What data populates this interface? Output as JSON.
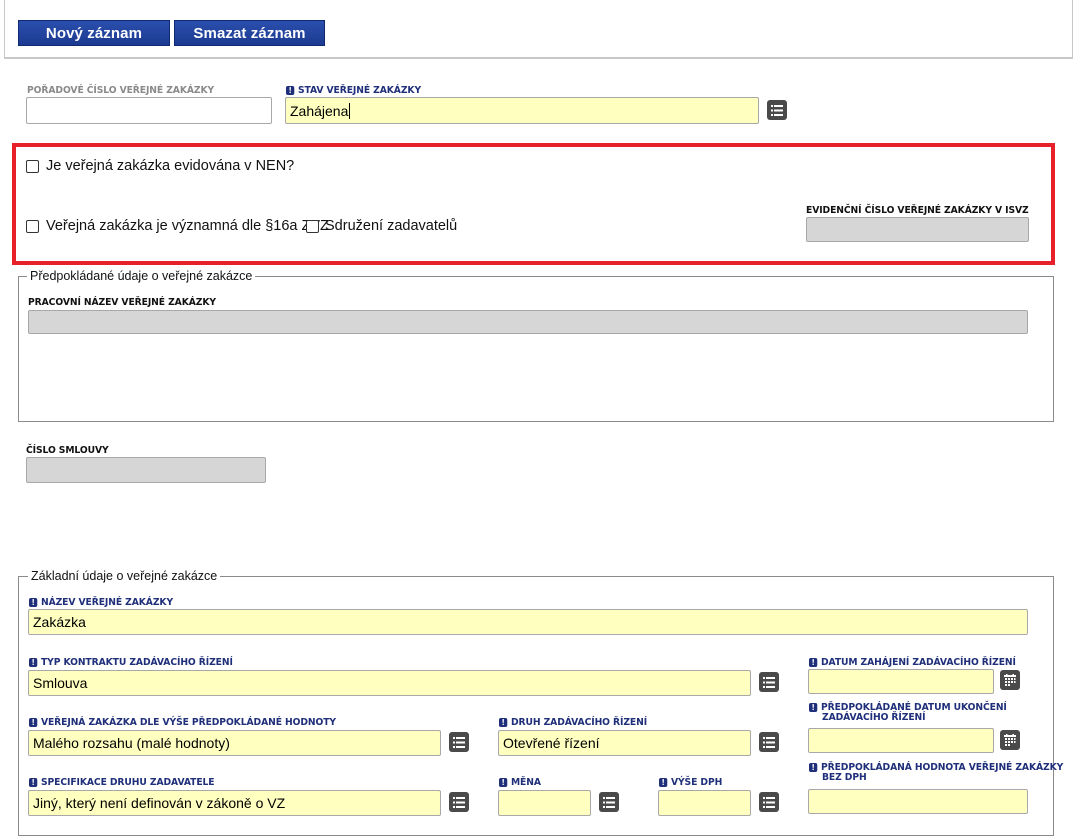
{
  "toolbar": {
    "new_label": "Nový záznam",
    "delete_label": "Smazat záznam"
  },
  "header_fields": {
    "order_number_label": "Pořadové číslo veřejné zakázky",
    "order_number_value": "",
    "status_label": "Stav veřejné zakázky",
    "status_value": "Zahájena"
  },
  "highlight": {
    "nen_label": "Je veřejná zakázka evidována v NEN?",
    "significant_label": "Veřejná zakázka je významná dle §16a ZVZ",
    "association_label": "Sdružení zadavatelů",
    "isvz_label": "Evidenční číslo veřejné zakázky v ISVZ",
    "isvz_value": ""
  },
  "expected": {
    "legend": "Předpokládané údaje o veřejné zakázce",
    "working_name_label": "Pracovní název veřejné zakázky",
    "working_name_value": ""
  },
  "contract": {
    "number_label": "Číslo smlouvy",
    "number_value": ""
  },
  "basic": {
    "legend": "Základní údaje o veřejné zakázce",
    "name_label": "Název veřejné zakázky",
    "name_value": "Zakázka",
    "contract_type_label": "Typ kontraktu zadávacího řízení",
    "contract_type_value": "Smlouva",
    "start_date_label": "Datum zahájení zadávacího řízení",
    "start_date_value": "",
    "value_size_label": "Veřejná zakázka dle výše předpokládané hodnoty",
    "value_size_value": "Malého rozsahu (malé hodnoty)",
    "procedure_type_label": "Druh zadávacího řízení",
    "procedure_type_value": "Otevřené řízení",
    "end_date_label_1": "Předpokládané datum ukončení",
    "end_date_label_2": "zadávacího řízení",
    "end_date_value": "",
    "contractor_spec_label": "Specifikace druhu zadavatele",
    "contractor_spec_value": "Jiný, který není definován v zákoně o VZ",
    "currency_label": "Měna",
    "currency_value": "",
    "vat_label": "Výše DPH",
    "vat_value": "",
    "est_value_label_1": "Předpokládaná hodnota veřejné zakázky",
    "est_value_label_2": "bez DPH",
    "est_value_value": ""
  }
}
